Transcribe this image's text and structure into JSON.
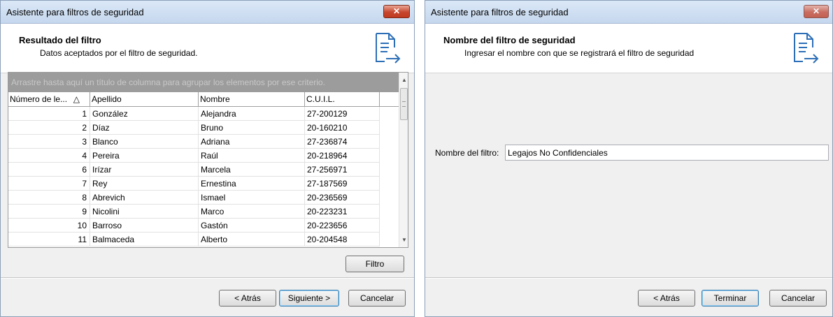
{
  "window_left": {
    "title": "Asistente para filtros de seguridad",
    "close_glyph": "✕",
    "header_title": "Resultado del filtro",
    "header_subtitle": "Datos aceptados por el filtro de seguridad.",
    "group_panel_text": "Arrastre hasta aquí un título de columna para agrupar los elementos por ese criterio.",
    "columns": [
      "Número de le...",
      "Apellido",
      "Nombre",
      "C.U.I.L."
    ],
    "sort_indicator": "△",
    "rows": [
      {
        "num": "1",
        "apellido": "González",
        "nombre": "Alejandra",
        "cuil": "27-200129"
      },
      {
        "num": "2",
        "apellido": "Díaz",
        "nombre": "Bruno",
        "cuil": "20-160210"
      },
      {
        "num": "3",
        "apellido": "Blanco",
        "nombre": "Adriana",
        "cuil": "27-236874"
      },
      {
        "num": "4",
        "apellido": "Pereira",
        "nombre": "Raúl",
        "cuil": "20-218964"
      },
      {
        "num": "6",
        "apellido": "Irízar",
        "nombre": "Marcela",
        "cuil": "27-256971"
      },
      {
        "num": "7",
        "apellido": "Rey",
        "nombre": "Ernestina",
        "cuil": "27-187569"
      },
      {
        "num": "8",
        "apellido": "Abrevich",
        "nombre": "Ismael",
        "cuil": "20-236569"
      },
      {
        "num": "9",
        "apellido": "Nicolini",
        "nombre": "Marco",
        "cuil": "20-223231"
      },
      {
        "num": "10",
        "apellido": "Barroso",
        "nombre": "Gastón",
        "cuil": "20-223656"
      },
      {
        "num": "11",
        "apellido": "Balmaceda",
        "nombre": "Alberto",
        "cuil": "20-204548"
      }
    ],
    "filter_button": "Filtro",
    "back_button": "< Atrás",
    "next_button": "Siguiente >",
    "cancel_button": "Cancelar",
    "icon": "document-arrow-icon"
  },
  "window_right": {
    "title": "Asistente para filtros de seguridad",
    "close_glyph": "✕",
    "header_title": "Nombre del filtro de seguridad",
    "header_subtitle": "Ingresar el nombre con que se registrará el filtro de seguridad",
    "field_label": "Nombre del filtro:",
    "field_value": "Legajos No Confidenciales",
    "back_button": "< Atrás",
    "finish_button": "Terminar",
    "cancel_button": "Cancelar",
    "icon": "document-arrow-icon"
  },
  "colors": {
    "accent_blue": "#3c7fb1",
    "close_red": "#c7462f",
    "group_panel": "#9c9c9c"
  }
}
